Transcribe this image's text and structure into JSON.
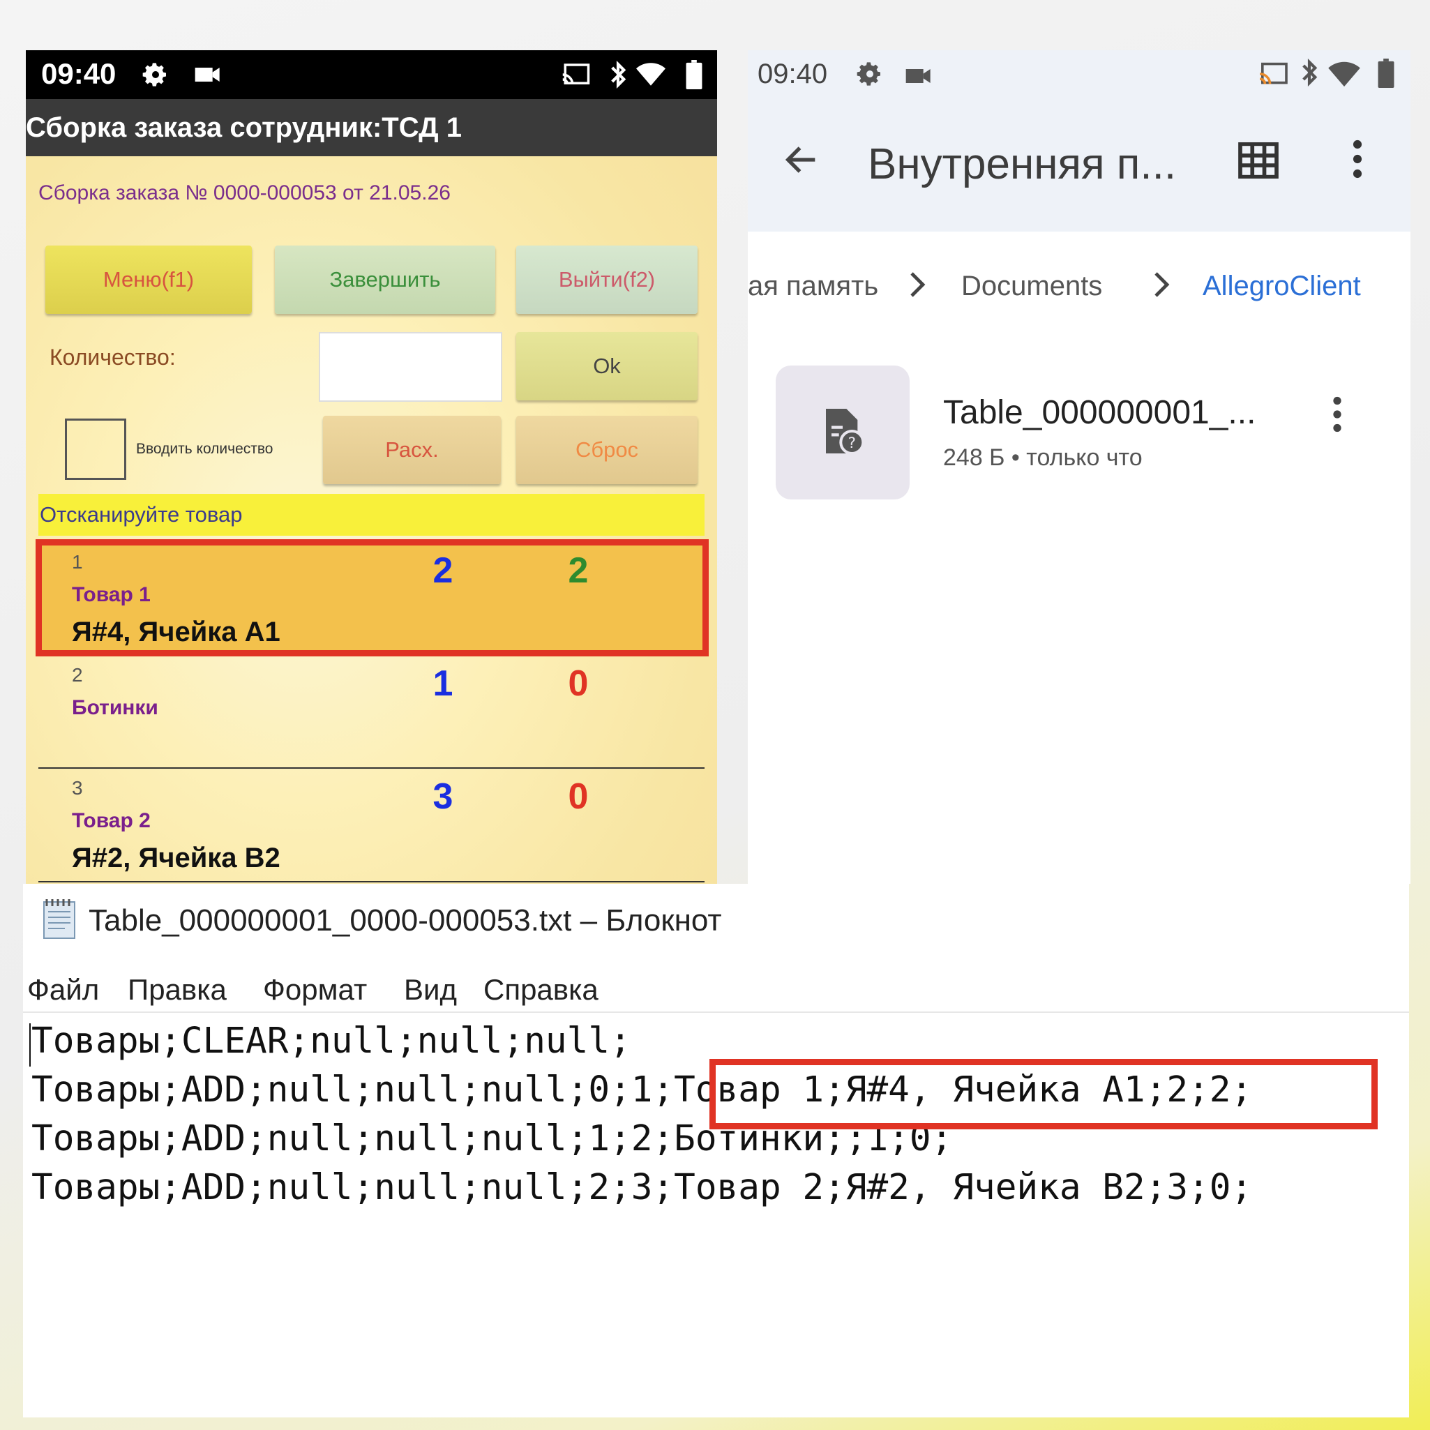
{
  "left_app": {
    "status": {
      "time": "09:40"
    },
    "title": "Сборка заказа сотрудник:ТСД 1",
    "order_line": "Сборка заказа № 0000-000053 от 21.05.26",
    "buttons": {
      "menu": "Меню(f1)",
      "finish": "Завершить",
      "exit": "Выйти(f2)",
      "ok": "Ok",
      "rash": "Расх.",
      "reset": "Сброс"
    },
    "quantity_label": "Количество:",
    "quantity_value": "",
    "checkbox_label": "Вводить количество",
    "scan_prompt": "Отсканируйте товар",
    "rows": [
      {
        "num": "1",
        "name": "Товар 1",
        "location": "Я#4, Ячейка A1",
        "qty_plan": "2",
        "qty_fact": "2",
        "fact_color": "#2e8b2e",
        "highlighted": true
      },
      {
        "num": "2",
        "name": "Ботинки",
        "location": "",
        "qty_plan": "1",
        "qty_fact": "0",
        "fact_color": "#e03324",
        "highlighted": false
      },
      {
        "num": "3",
        "name": "Товар 2",
        "location": "Я#2, Ячейка B2",
        "qty_plan": "3",
        "qty_fact": "0",
        "fact_color": "#e03324",
        "highlighted": false
      }
    ],
    "colors": {
      "plan_qty": "#1a2ee0",
      "highlight_frame": "#e03324",
      "highlight_row": "#f3c14c"
    }
  },
  "right_app": {
    "status": {
      "time": "09:40"
    },
    "title": "Внутренняя п...",
    "breadcrumbs": [
      "ая память",
      "Documents",
      "AllegroClient"
    ],
    "file": {
      "name": "Table_000000001_...",
      "meta": "248 Б • только что"
    },
    "icons": [
      "back-arrow-icon",
      "grid-view-icon",
      "more-vert-icon",
      "file-unknown-icon"
    ]
  },
  "notepad": {
    "title": "Table_000000001_0000-000053.txt – Блокнот",
    "menu": [
      "Файл",
      "Правка",
      "Формат",
      "Вид",
      "Справка"
    ],
    "lines": [
      "Товары;CLEAR;null;null;null;",
      "Товары;ADD;null;null;null;0;1;Товар 1;Я#4, Ячейка A1;2;2;",
      "Товары;ADD;null;null;null;1;2;Ботинки;;1;0;",
      "Товары;ADD;null;null;null;2;3;Товар 2;Я#2, Ячейка B2;3;0;"
    ]
  }
}
